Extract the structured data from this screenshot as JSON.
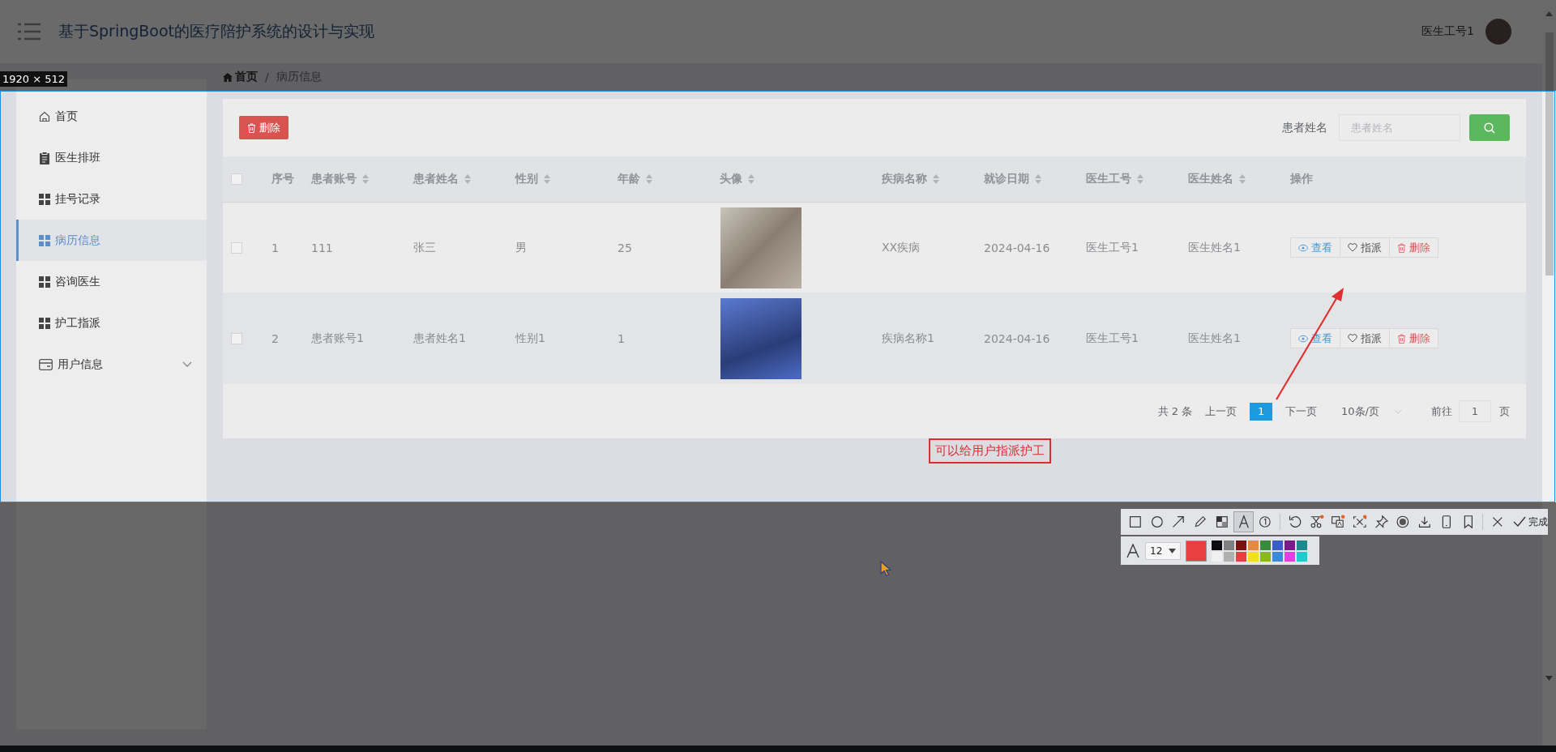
{
  "header": {
    "title": "基于SpringBoot的医疗陪护系统的设计与实现",
    "user": "医生工号1"
  },
  "breadcrumb": [
    {
      "kind": "home",
      "label": "首页"
    },
    {
      "kind": "separator",
      "label": "/"
    },
    {
      "kind": "text",
      "label": "病历信息"
    }
  ],
  "sidebar": {
    "items": [
      {
        "label": "首页",
        "kind": "home",
        "selected": false
      },
      {
        "label": "医生排班",
        "kind": "clipboard",
        "selected": false
      },
      {
        "label": "挂号记录",
        "kind": "grid",
        "selected": false
      },
      {
        "label": "病历信息",
        "kind": "grid",
        "selected": true
      },
      {
        "label": "咨询医生",
        "kind": "grid",
        "selected": false
      },
      {
        "label": "护工指派",
        "kind": "grid",
        "selected": false
      },
      {
        "label": "用户信息",
        "kind": "submenu",
        "selected": false
      }
    ]
  },
  "toolbar": {
    "delete_button": "删除",
    "search_label": "患者姓名",
    "search": {
      "placeholder": "患者姓名"
    }
  },
  "table": {
    "columns": [
      {
        "kind": "checkbox",
        "checked": false
      },
      {
        "kind": "text",
        "label": "序号",
        "sortable": false
      },
      {
        "kind": "text",
        "label": "患者账号",
        "sortable": true
      },
      {
        "kind": "text",
        "label": "患者姓名",
        "sortable": true
      },
      {
        "kind": "text",
        "label": "性别",
        "sortable": true
      },
      {
        "kind": "text",
        "label": "年龄",
        "sortable": true
      },
      {
        "kind": "text",
        "label": "头像",
        "sortable": true
      },
      {
        "kind": "text",
        "label": "疾病名称",
        "sortable": true
      },
      {
        "kind": "text",
        "label": "就诊日期",
        "sortable": true
      },
      {
        "kind": "text",
        "label": "医生工号",
        "sortable": true
      },
      {
        "kind": "text",
        "label": "医生姓名",
        "sortable": true
      },
      {
        "kind": "text",
        "label": "操作",
        "sortable": false
      }
    ],
    "rows": [
      {
        "cells": [
          {
            "kind": "checkbox",
            "checked": false
          },
          {
            "kind": "text",
            "text": "1"
          },
          {
            "kind": "text",
            "text": "111"
          },
          {
            "kind": "text",
            "text": "张三"
          },
          {
            "kind": "text",
            "text": "男"
          },
          {
            "kind": "text",
            "text": "25"
          },
          {
            "kind": "photo"
          },
          {
            "kind": "text",
            "text": "XX疾病"
          },
          {
            "kind": "text",
            "text": "2024-04-16"
          },
          {
            "kind": "text",
            "text": "医生工号1"
          },
          {
            "kind": "text",
            "text": "医生姓名1"
          },
          {
            "kind": "actions",
            "actions": [
              {
                "kind": "view",
                "label": "查看"
              },
              {
                "kind": "assign",
                "label": "指派"
              },
              {
                "kind": "delete",
                "label": "删除"
              }
            ]
          }
        ]
      },
      {
        "cells": [
          {
            "kind": "checkbox",
            "checked": false
          },
          {
            "kind": "text",
            "text": "2"
          },
          {
            "kind": "text",
            "text": "患者账号1"
          },
          {
            "kind": "text",
            "text": "患者姓名1"
          },
          {
            "kind": "text",
            "text": "性别1"
          },
          {
            "kind": "text",
            "text": "1"
          },
          {
            "kind": "photo"
          },
          {
            "kind": "text",
            "text": "疾病名称1"
          },
          {
            "kind": "text",
            "text": "2024-04-16"
          },
          {
            "kind": "text",
            "text": "医生工号1"
          },
          {
            "kind": "text",
            "text": "医生姓名1"
          },
          {
            "kind": "actions",
            "actions": [
              {
                "kind": "view",
                "label": "查看"
              },
              {
                "kind": "assign",
                "label": "指派"
              },
              {
                "kind": "delete",
                "label": "删除"
              }
            ]
          }
        ]
      }
    ]
  },
  "pagination": {
    "total": "共 2 条",
    "prev": "上一页",
    "pages": [
      {
        "label": "1",
        "selected": true
      }
    ],
    "next": "下一页",
    "page_size": "10条/页",
    "goto": "前往",
    "goto_value": "1",
    "page_unit": "页"
  },
  "capture": {
    "selection_size": "1920 × 512",
    "note": "可以给用户指派护工"
  },
  "snip_toolbar": {
    "tools": [
      {
        "kind": "rect",
        "selected": false
      },
      {
        "kind": "ellipse",
        "selected": false
      },
      {
        "kind": "arrow",
        "selected": false
      },
      {
        "kind": "pen",
        "selected": false
      },
      {
        "kind": "mosaic",
        "selected": false
      },
      {
        "kind": "text",
        "selected": true
      },
      {
        "kind": "number",
        "selected": false
      },
      {
        "kind": "undo",
        "selected": false
      },
      {
        "kind": "clip",
        "selected": false
      },
      {
        "kind": "translate",
        "selected": false
      },
      {
        "kind": "ocr",
        "selected": false
      },
      {
        "kind": "pin",
        "selected": false
      },
      {
        "kind": "record",
        "selected": false
      },
      {
        "kind": "save",
        "selected": false
      },
      {
        "kind": "phone",
        "selected": false
      },
      {
        "kind": "bookmark",
        "selected": false
      },
      {
        "kind": "close",
        "selected": false
      }
    ],
    "done": "完成",
    "font_size": "12",
    "current_swatch": {
      "color": "#e84040"
    },
    "palette": [
      {
        "color": "#0c0c10"
      },
      {
        "color": "#808080"
      },
      {
        "color": "#7b1010"
      },
      {
        "color": "#e88a3c"
      },
      {
        "color": "#3b8a3b"
      },
      {
        "color": "#3b5ccc"
      },
      {
        "color": "#7b1a8a"
      },
      {
        "color": "#1a8a8a"
      },
      {
        "color": "#f0f0f0"
      },
      {
        "color": "#b0b0b0"
      },
      {
        "color": "#e84040"
      },
      {
        "color": "#f0e020"
      },
      {
        "color": "#8ab820"
      },
      {
        "color": "#3b8ad8"
      },
      {
        "color": "#e040e0"
      },
      {
        "color": "#20c8d0"
      }
    ]
  }
}
